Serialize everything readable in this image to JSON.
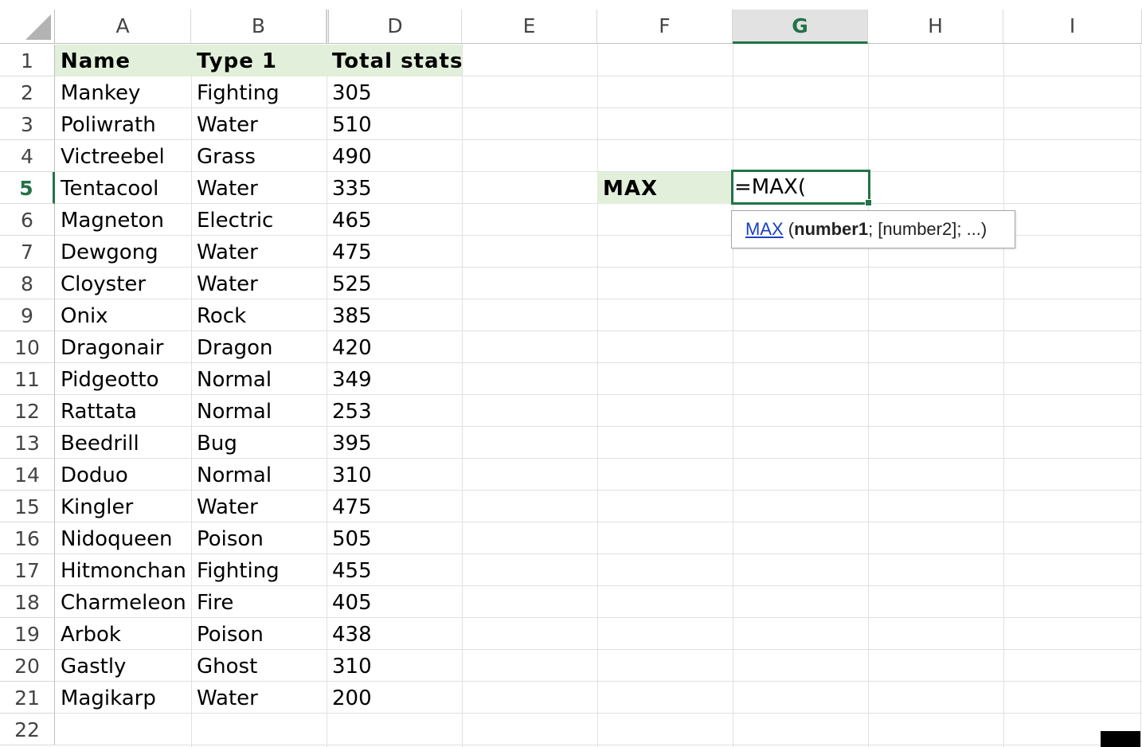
{
  "columns": [
    {
      "letter": "A"
    },
    {
      "letter": "B"
    },
    {
      "letter": "D"
    },
    {
      "letter": "E"
    },
    {
      "letter": "F"
    },
    {
      "letter": "G"
    },
    {
      "letter": "H"
    },
    {
      "letter": "I"
    }
  ],
  "selected_column": "G",
  "selected_row": "5",
  "headers": {
    "name": "Name",
    "type": "Type 1",
    "total": "Total stats"
  },
  "rows": [
    {
      "num": "2",
      "name": "Mankey",
      "type": "Fighting",
      "total": "305"
    },
    {
      "num": "3",
      "name": "Poliwrath",
      "type": "Water",
      "total": "510"
    },
    {
      "num": "4",
      "name": "Victreebel",
      "type": "Grass",
      "total": "490"
    },
    {
      "num": "5",
      "name": "Tentacool",
      "type": "Water",
      "total": "335"
    },
    {
      "num": "6",
      "name": "Magneton",
      "type": "Electric",
      "total": "465"
    },
    {
      "num": "7",
      "name": "Dewgong",
      "type": "Water",
      "total": "475"
    },
    {
      "num": "8",
      "name": "Cloyster",
      "type": "Water",
      "total": "525"
    },
    {
      "num": "9",
      "name": "Onix",
      "type": "Rock",
      "total": "385"
    },
    {
      "num": "10",
      "name": "Dragonair",
      "type": "Dragon",
      "total": "420"
    },
    {
      "num": "11",
      "name": "Pidgeotto",
      "type": "Normal",
      "total": "349"
    },
    {
      "num": "12",
      "name": "Rattata",
      "type": "Normal",
      "total": "253"
    },
    {
      "num": "13",
      "name": "Beedrill",
      "type": "Bug",
      "total": "395"
    },
    {
      "num": "14",
      "name": "Doduo",
      "type": "Normal",
      "total": "310"
    },
    {
      "num": "15",
      "name": "Kingler",
      "type": "Water",
      "total": "475"
    },
    {
      "num": "16",
      "name": "Nidoqueen",
      "type": "Poison",
      "total": "505"
    },
    {
      "num": "17",
      "name": "Hitmonchan",
      "type": "Fighting",
      "total": "455"
    },
    {
      "num": "18",
      "name": "Charmeleon",
      "type": "Fire",
      "total": "405"
    },
    {
      "num": "19",
      "name": "Arbok",
      "type": "Poison",
      "total": "438"
    },
    {
      "num": "20",
      "name": "Gastly",
      "type": "Ghost",
      "total": "310"
    },
    {
      "num": "21",
      "name": "Magikarp",
      "type": "Water",
      "total": "200"
    }
  ],
  "row_numbers": [
    "1",
    "2",
    "3",
    "4",
    "5",
    "6",
    "7",
    "8",
    "9",
    "10",
    "11",
    "12",
    "13",
    "14",
    "15",
    "16",
    "17",
    "18",
    "19",
    "20",
    "21",
    "22"
  ],
  "max_label": "MAX",
  "active_cell": {
    "formula": "=MAX("
  },
  "tooltip": {
    "fn": "MAX",
    "open": " (",
    "arg1": "number1",
    "rest": "; [number2]; ...)"
  },
  "colors": {
    "accent": "#217346",
    "header_fill": "#e2efda",
    "link": "#1a3fc4"
  }
}
